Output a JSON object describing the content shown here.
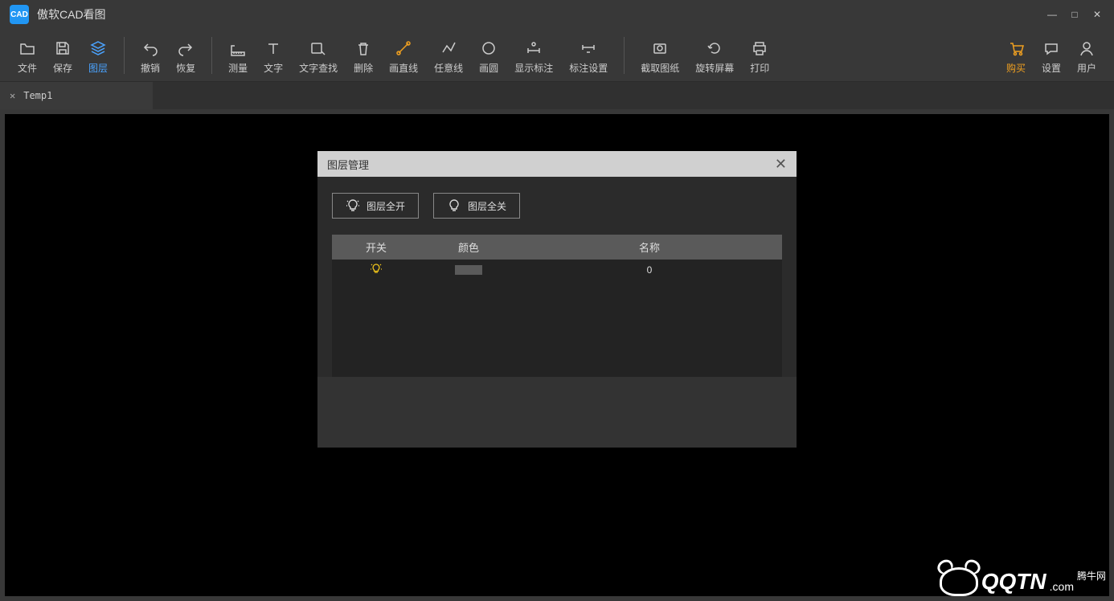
{
  "app": {
    "title": "傲软CAD看图"
  },
  "window": {
    "min": "—",
    "max": "□",
    "close": "✕"
  },
  "toolbar": {
    "file": "文件",
    "save": "保存",
    "layer": "图层",
    "undo": "撤销",
    "redo": "恢复",
    "measure": "测量",
    "text": "文字",
    "findtext": "文字查找",
    "delete": "删除",
    "line": "画直线",
    "polyline": "任意线",
    "circle": "画圆",
    "showdim": "显示标注",
    "dimsettings": "标注设置",
    "capture": "截取图纸",
    "rotate": "旋转屏幕",
    "print": "打印",
    "buy": "购买",
    "settings": "设置",
    "user": "用户"
  },
  "tab": {
    "name": "Temp1"
  },
  "dialog": {
    "title": "图层管理",
    "all_on": "图层全开",
    "all_off": "图层全关",
    "cols": {
      "switch": "开关",
      "color": "颜色",
      "name": "名称"
    },
    "rows": [
      {
        "on": true,
        "name": "0"
      }
    ]
  },
  "watermark": {
    "brand": "QQTN",
    "suffix": ".com",
    "cn": "腾牛网"
  }
}
